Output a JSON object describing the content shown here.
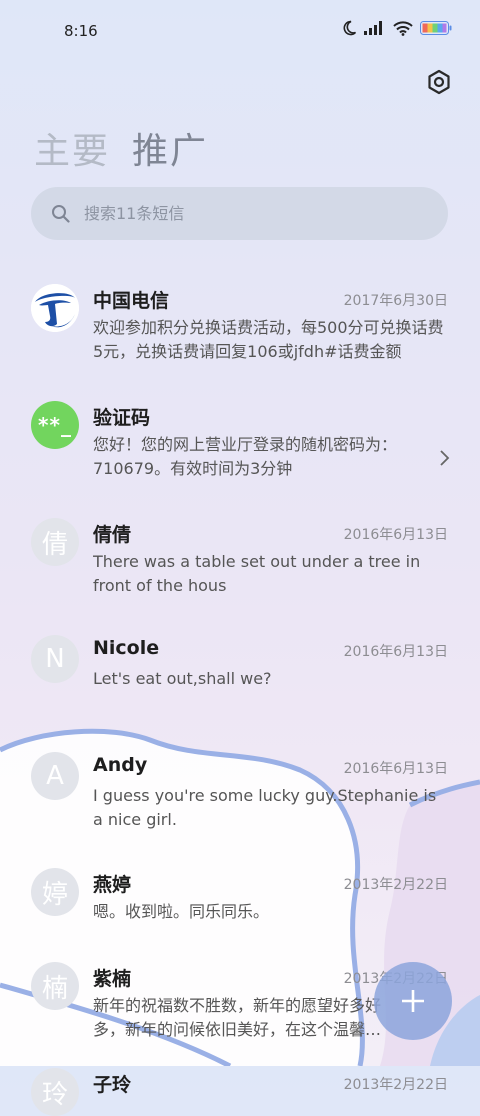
{
  "status_bar": {
    "time": "8:16",
    "icons": [
      "moon-icon",
      "signal-icon",
      "wifi-icon",
      "battery-icon"
    ]
  },
  "header": {
    "settings_icon": "gear-icon",
    "tabs": [
      {
        "label": "主要",
        "selected": false
      },
      {
        "label": "推广",
        "selected": true
      }
    ]
  },
  "search": {
    "placeholder": "搜索11条短信",
    "icon": "search-icon"
  },
  "messages": [
    {
      "avatar": "",
      "avatar_type": "china-telecom-logo",
      "name": "中国电信",
      "date": "2017年6月30日",
      "preview": "欢迎参加积分兑换话费活动，每500分可兑换话费5元，兑换话费请回复106或jfdh#话费金额"
    },
    {
      "avatar": "**_",
      "avatar_type": "code",
      "name": "验证码",
      "date": "",
      "preview": "您好！您的网上营业厅登录的随机密码为：710679。有效时间为3分钟"
    },
    {
      "avatar": "倩",
      "avatar_type": "initial",
      "name": "倩倩",
      "date": "2016年6月13日",
      "preview": "There was a table set out under a tree in front of the hous"
    },
    {
      "avatar": "N",
      "avatar_type": "initial",
      "name": "Nicole",
      "date": "2016年6月13日",
      "preview": "Let's eat out,shall we?"
    },
    {
      "avatar": "A",
      "avatar_type": "initial",
      "name": "Andy",
      "date": "2016年6月13日",
      "preview": "I guess you're some lucky guy.Stephanie is a nice girl."
    },
    {
      "avatar": "婷",
      "avatar_type": "initial",
      "name": "燕婷",
      "date": "2013年2月22日",
      "preview": "嗯。收到啦。同乐同乐。"
    },
    {
      "avatar": "楠",
      "avatar_type": "initial",
      "name": "紫楠",
      "date": "2013年2月22日",
      "preview": "新年的祝福数不胜数，新年的愿望好多好多，新年的问候依旧美好，在这个温馨的节日里"
    },
    {
      "avatar": "玲",
      "avatar_type": "initial",
      "name": "子玲",
      "date": "2013年2月22日",
      "preview": ""
    }
  ],
  "fab": {
    "icon": "plus-icon"
  },
  "colors": {
    "accent": "#8ca5dc",
    "code_avatar": "#72d55e",
    "telecom_blue": "#1d4fa6"
  }
}
